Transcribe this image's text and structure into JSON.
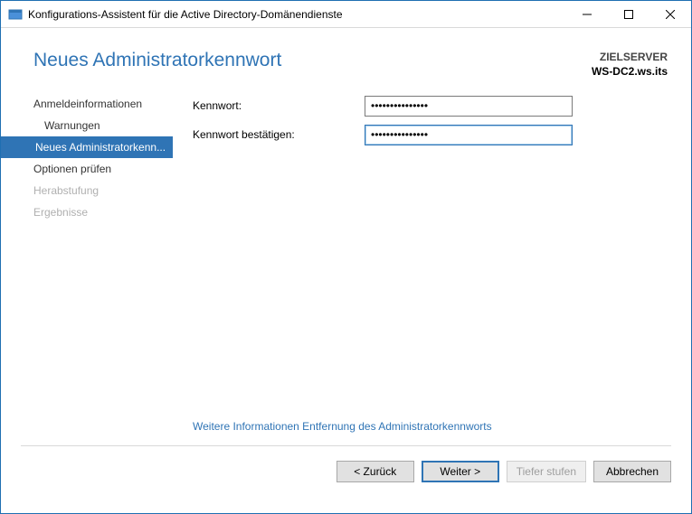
{
  "window": {
    "title": "Konfigurations-Assistent für die Active Directory-Domänendienste"
  },
  "header": {
    "page_title": "Neues Administratorkennwort",
    "target_label": "ZIELSERVER",
    "target_value": "WS-DC2.ws.its"
  },
  "sidebar": {
    "items": [
      {
        "label": "Anmeldeinformationen",
        "state": "normal",
        "child": false
      },
      {
        "label": "Warnungen",
        "state": "normal",
        "child": true
      },
      {
        "label": "Neues Administratorkenn...",
        "state": "active",
        "child": false
      },
      {
        "label": "Optionen prüfen",
        "state": "normal",
        "child": false
      },
      {
        "label": "Herabstufung",
        "state": "disabled",
        "child": false
      },
      {
        "label": "Ergebnisse",
        "state": "disabled",
        "child": false
      }
    ]
  },
  "form": {
    "password_label": "Kennwort:",
    "password_value": "●●●●●●●●●●●●●●●",
    "confirm_label": "Kennwort bestätigen:",
    "confirm_value": "●●●●●●●●●●●●●●●"
  },
  "link": {
    "more_info": "Weitere Informationen Entfernung des Administratorkennworts"
  },
  "footer": {
    "back": "<  Zurück",
    "next": "Weiter  >",
    "demote": "Tiefer stufen",
    "cancel": "Abbrechen"
  }
}
